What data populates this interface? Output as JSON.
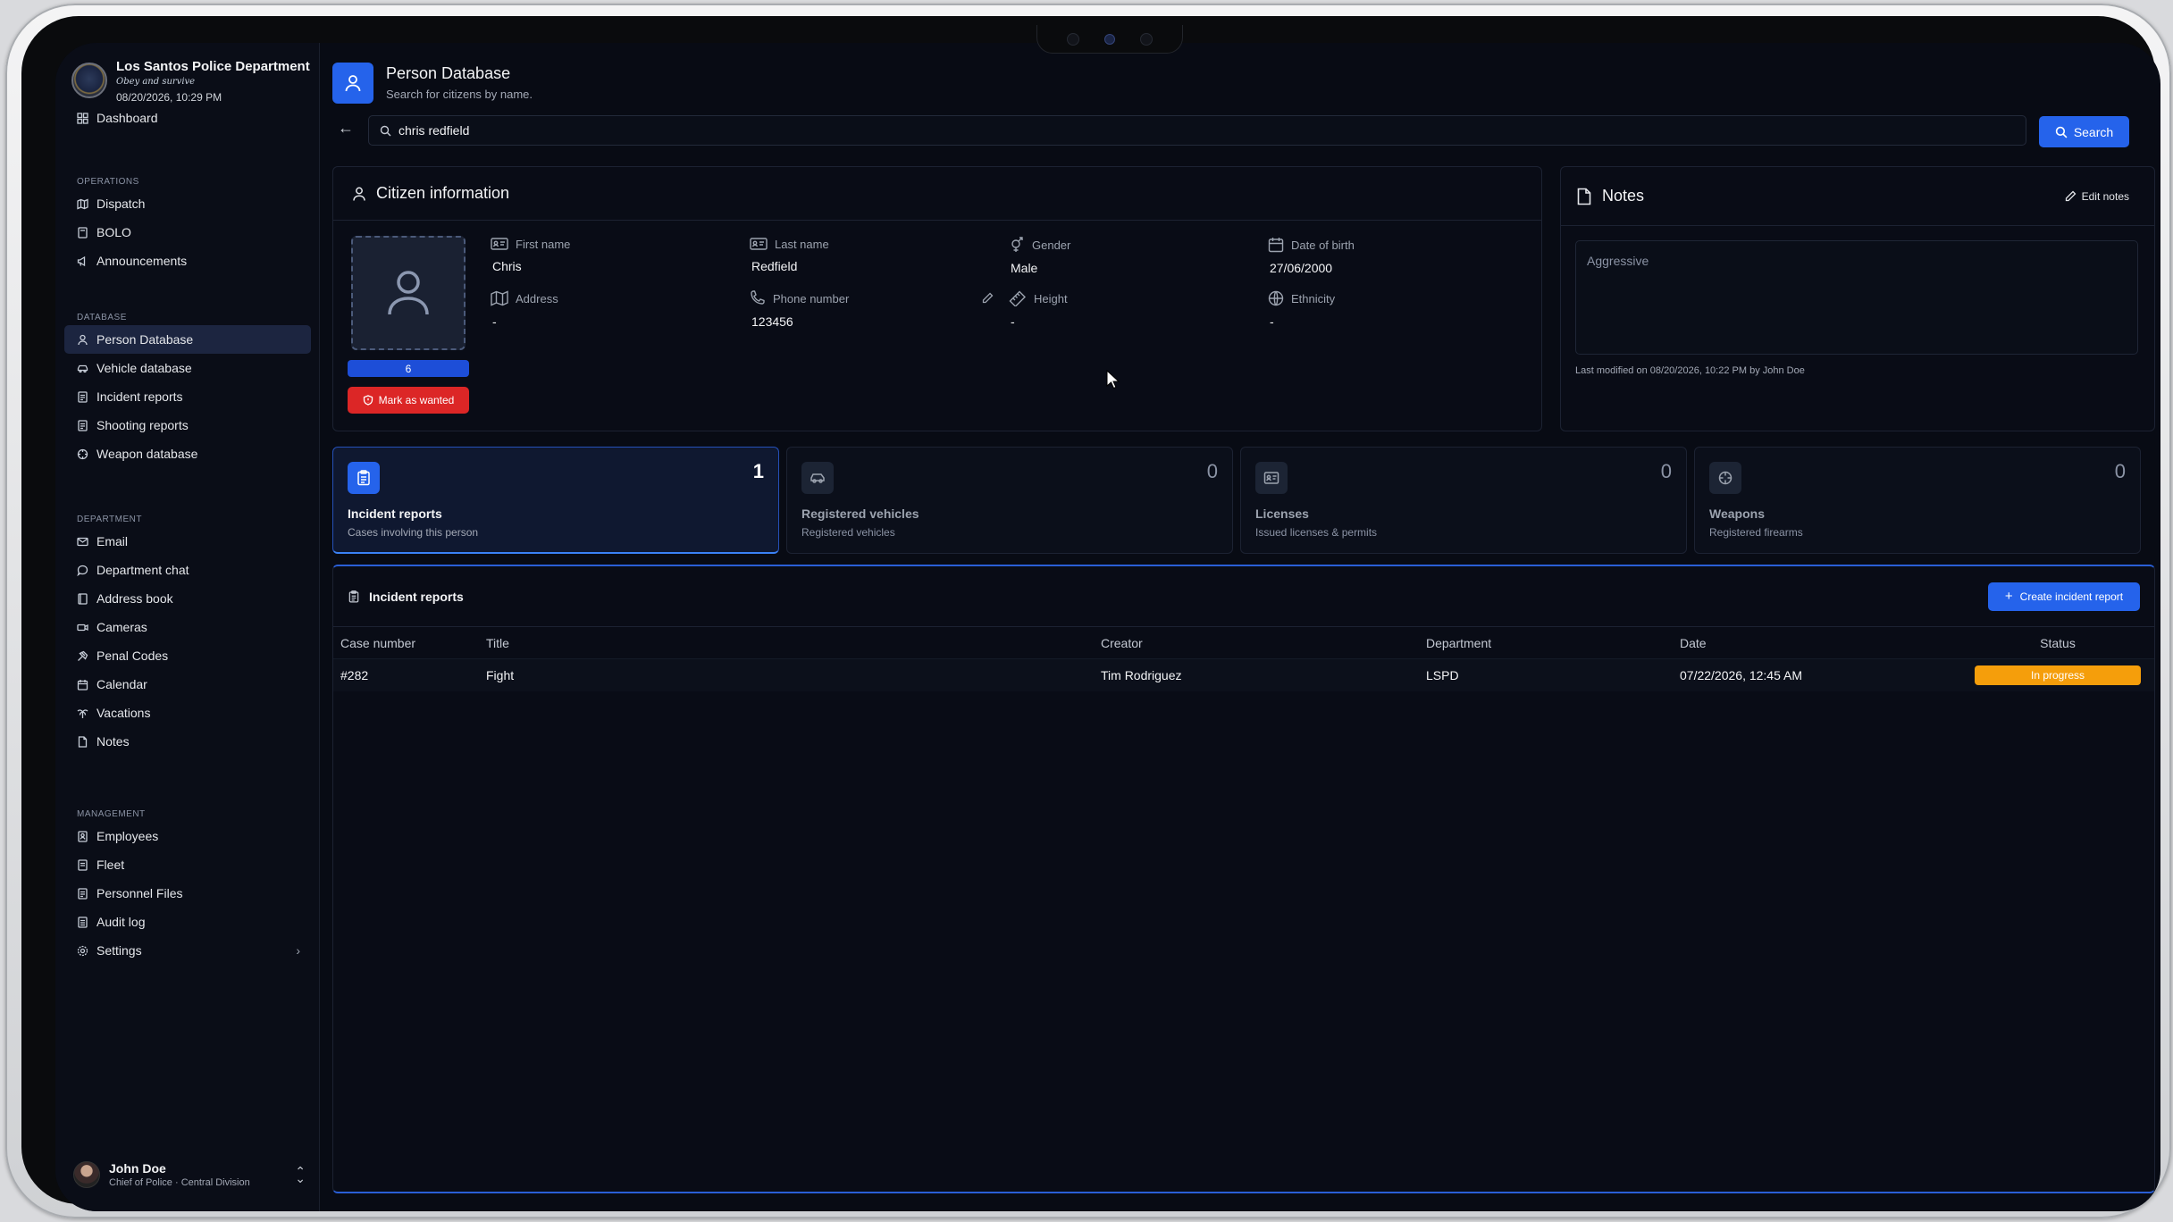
{
  "app": {
    "name": "Los Santos Police Department",
    "motto": "Obey and survive",
    "datetime": "08/20/2026, 10:29 PM"
  },
  "sidebar": {
    "top_items": [
      {
        "label": "Dashboard",
        "icon": "dashboard-icon"
      }
    ],
    "sections": [
      {
        "label": "OPERATIONS",
        "items": [
          {
            "label": "Dispatch",
            "icon": "map-icon"
          },
          {
            "label": "BOLO",
            "icon": "book-icon"
          },
          {
            "label": "Announcements",
            "icon": "megaphone-icon"
          }
        ]
      },
      {
        "label": "DATABASE",
        "items": [
          {
            "label": "Person Database",
            "icon": "person-icon",
            "active": true
          },
          {
            "label": "Vehicle database",
            "icon": "car-icon"
          },
          {
            "label": "Incident reports",
            "icon": "file-icon"
          },
          {
            "label": "Shooting reports",
            "icon": "file-icon"
          },
          {
            "label": "Weapon database",
            "icon": "crosshair-icon"
          }
        ]
      },
      {
        "label": "DEPARTMENT",
        "items": [
          {
            "label": "Email",
            "icon": "mail-icon"
          },
          {
            "label": "Department chat",
            "icon": "chat-icon"
          },
          {
            "label": "Address book",
            "icon": "book-icon"
          },
          {
            "label": "Cameras",
            "icon": "camera-icon"
          },
          {
            "label": "Penal Codes",
            "icon": "gavel-icon"
          },
          {
            "label": "Calendar",
            "icon": "calendar-icon"
          },
          {
            "label": "Vacations",
            "icon": "palm-icon"
          },
          {
            "label": "Notes",
            "icon": "note-icon"
          }
        ]
      },
      {
        "label": "MANAGEMENT",
        "items": [
          {
            "label": "Employees",
            "icon": "employees-icon"
          },
          {
            "label": "Fleet",
            "icon": "fleet-icon"
          },
          {
            "label": "Personnel Files",
            "icon": "folder-icon"
          },
          {
            "label": "Audit log",
            "icon": "log-icon"
          },
          {
            "label": "Settings",
            "icon": "gear-icon",
            "chevron": true
          }
        ]
      }
    ],
    "user": {
      "name": "John Doe",
      "role": "Chief of Police · Central Division"
    }
  },
  "header": {
    "title": "Person Database",
    "subtitle": "Search for citizens by name."
  },
  "search": {
    "value": "chris redfield",
    "button_label": "Search"
  },
  "citizen": {
    "heading": "Citizen information",
    "photo_count": "6",
    "wanted_label": "Mark as wanted",
    "fields": {
      "first_name": {
        "label": "First name",
        "value": "Chris"
      },
      "last_name": {
        "label": "Last name",
        "value": "Redfield"
      },
      "gender": {
        "label": "Gender",
        "value": "Male"
      },
      "dob": {
        "label": "Date of birth",
        "value": "27/06/2000"
      },
      "address": {
        "label": "Address",
        "value": "-"
      },
      "phone": {
        "label": "Phone number",
        "value": "123456"
      },
      "height": {
        "label": "Height",
        "value": "-"
      },
      "ethnicity": {
        "label": "Ethnicity",
        "value": "-"
      }
    }
  },
  "notes": {
    "heading": "Notes",
    "edit_label": "Edit notes",
    "content": "Aggressive",
    "meta": "Last modified on 08/20/2026, 10:22 PM by John Doe"
  },
  "stats": [
    {
      "title": "Incident reports",
      "subtitle": "Cases involving this person",
      "count": "1",
      "icon": "clipboard-icon",
      "active": true
    },
    {
      "title": "Registered vehicles",
      "subtitle": "Registered vehicles",
      "count": "0",
      "icon": "car-icon"
    },
    {
      "title": "Licenses",
      "subtitle": "Issued licenses & permits",
      "count": "0",
      "icon": "id-card-icon"
    },
    {
      "title": "Weapons",
      "subtitle": "Registered firearms",
      "count": "0",
      "icon": "crosshair-icon"
    }
  ],
  "reports": {
    "heading": "Incident reports",
    "create_label": "Create incident report",
    "columns": [
      "Case number",
      "Title",
      "Creator",
      "Department",
      "Date",
      "Status"
    ],
    "rows": [
      {
        "case": "#282",
        "title": "Fight",
        "creator": "Tim Rodriguez",
        "department": "LSPD",
        "date": "07/22/2026, 12:45 AM",
        "status": "In progress"
      }
    ]
  },
  "colors": {
    "accent": "#2563eb",
    "danger": "#dc2626",
    "warning": "#f59e0b",
    "background": "#080b14"
  }
}
